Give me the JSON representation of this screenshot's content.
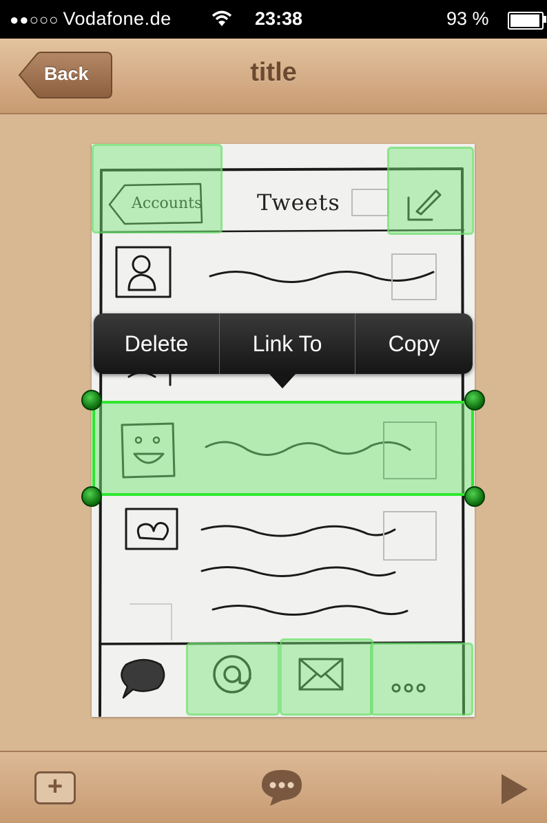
{
  "status_bar": {
    "signal": "●●○○○",
    "carrier": "Vodafone.de",
    "wifi_icon": "wifi-icon",
    "time": "23:38",
    "battery": "93 %"
  },
  "nav": {
    "back_label": "Back",
    "title": "title"
  },
  "sketch": {
    "back_label": "Accounts",
    "title": "Tweets",
    "compose_icon": "compose-icon",
    "rows": [
      "user-icon",
      "user-icon",
      "smiley-icon",
      "heart-icon"
    ],
    "tabs": [
      "speech-bubble-icon",
      "at-icon",
      "envelope-icon",
      "more-icon"
    ]
  },
  "context_menu": {
    "items": [
      "Delete",
      "Link To",
      "Copy"
    ]
  },
  "toolbar": {
    "add_icon": "add-icon",
    "comment_icon": "comment-icon",
    "play_icon": "play-icon"
  },
  "colors": {
    "hotspot": "#78e678",
    "selection_border": "#2ee62e",
    "wood": "#d8b793"
  }
}
